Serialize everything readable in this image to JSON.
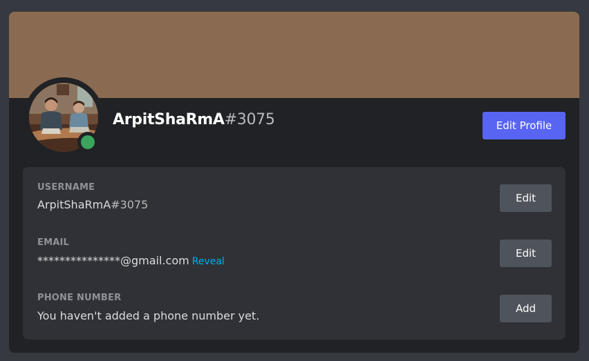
{
  "profile": {
    "username": "ArpitShaRmA",
    "discriminator": "#3075",
    "edit_profile_label": "Edit Profile",
    "status": "online",
    "status_color": "#3ba55d",
    "banner_color": "#8a6b52",
    "accent_color": "#5865f2"
  },
  "fields": {
    "username": {
      "label": "USERNAME",
      "value": "ArpitShaRmA",
      "discriminator": "#3075",
      "button_label": "Edit"
    },
    "email": {
      "label": "EMAIL",
      "value": "***************@gmail.com",
      "reveal_label": "Reveal",
      "button_label": "Edit"
    },
    "phone": {
      "label": "PHONE NUMBER",
      "value": "You haven't added a phone number yet.",
      "button_label": "Add"
    }
  }
}
